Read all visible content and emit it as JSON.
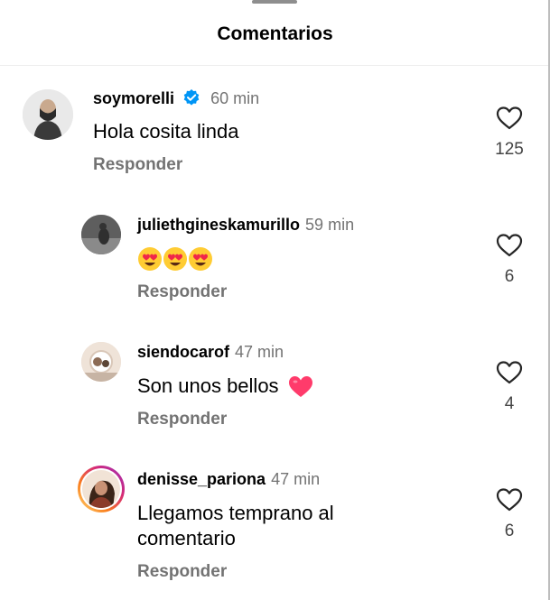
{
  "header": {
    "title": "Comentarios"
  },
  "comments": [
    {
      "username": "soymorelli",
      "verified": true,
      "time": "60 min",
      "text": "Hola cosita linda",
      "reply_label": "Responder",
      "likes": "125"
    },
    {
      "username": "juliethgineskamurillo",
      "time": "59 min",
      "text_icons": [
        "heart-eyes-emoji",
        "heart-eyes-emoji",
        "heart-eyes-emoji"
      ],
      "reply_label": "Responder",
      "likes": "6"
    },
    {
      "username": "siendocarof",
      "time": "47 min",
      "text": "Son unos bellos",
      "text_icon": "pink-heart-emoji",
      "reply_label": "Responder",
      "likes": "4"
    },
    {
      "username": "denisse_pariona",
      "time": "47 min",
      "text_line1": "Llegamos temprano al",
      "text_line2": "comentario",
      "reply_label": "Responder",
      "likes": "6",
      "story_ring": true
    }
  ],
  "colors": {
    "verified": "#0095f6",
    "secondary": "#737373",
    "heart_pink": "#ff3b6b",
    "story_ring": "#d3247f"
  }
}
